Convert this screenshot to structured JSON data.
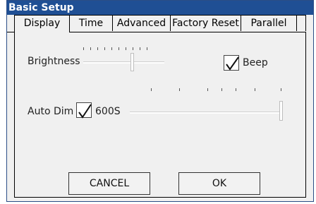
{
  "window": {
    "title": "Basic Setup"
  },
  "tabs": [
    "Display",
    "Time",
    "Advanced",
    "Factory Reset",
    "Parallel"
  ],
  "active_tab": "Display",
  "display": {
    "brightness_label": "Brightness",
    "beep_label": "Beep",
    "beep_checked": true,
    "auto_dim_label": "Auto Dim",
    "auto_dim_checked": true,
    "auto_dim_value": "600S"
  },
  "buttons": {
    "cancel": "CANCEL",
    "ok": "OK"
  }
}
